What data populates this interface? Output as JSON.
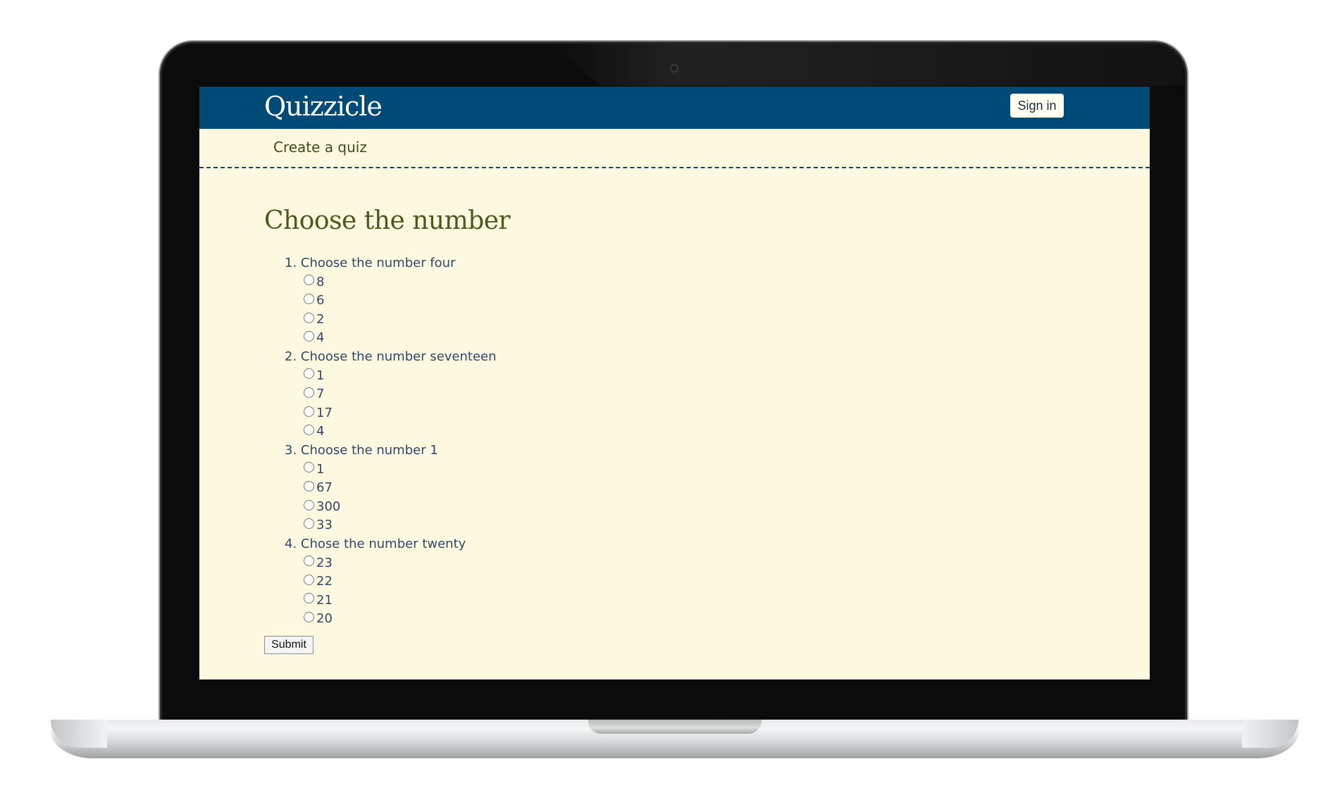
{
  "app": {
    "logo": "Quizzicle",
    "sign_in_label": "Sign in",
    "nav_link": "Create a quiz"
  },
  "quiz": {
    "title": "Choose the number",
    "questions": [
      {
        "number": "1.",
        "text": "Choose the number four",
        "options": [
          "8",
          "6",
          "2",
          "4"
        ]
      },
      {
        "number": "2.",
        "text": "Choose the number seventeen",
        "options": [
          "1",
          "7",
          "17",
          "4"
        ]
      },
      {
        "number": "3.",
        "text": "Choose the number 1",
        "options": [
          "1",
          "67",
          "300",
          "33"
        ]
      },
      {
        "number": "4.",
        "text": "Chose the number twenty",
        "options": [
          "23",
          "22",
          "21",
          "20"
        ]
      }
    ],
    "submit_label": "Submit"
  },
  "colors": {
    "header_bg": "#004a77",
    "page_bg": "#fdf9e1",
    "title_color": "#4b5a1c",
    "question_text_color": "#304868"
  }
}
